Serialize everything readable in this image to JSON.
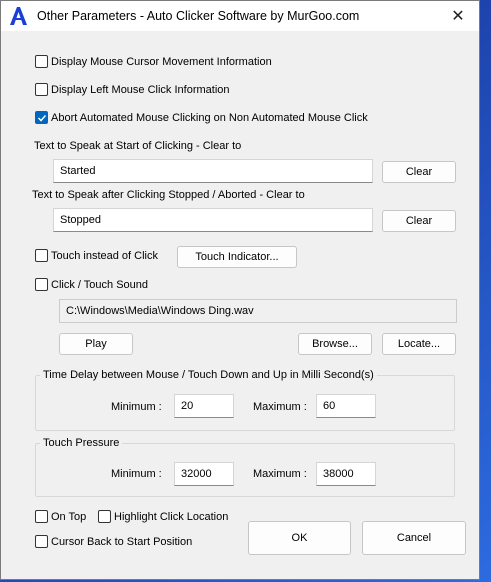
{
  "window": {
    "title": "Other Parameters - Auto Clicker Software by MurGoo.com",
    "close_glyph": "✕"
  },
  "options": {
    "display_cursor_movement": "Display Mouse Cursor Movement Information",
    "display_left_click": "Display Left Mouse Click Information",
    "abort_on_non_automated": "Abort Automated Mouse Clicking on Non Automated Mouse Click"
  },
  "speak_start": {
    "label": "Text to Speak at Start of Clicking - Clear to",
    "value": "Started",
    "clear_label": "Clear"
  },
  "speak_stop": {
    "label": "Text to Speak after Clicking Stopped / Aborted - Clear to",
    "value": "Stopped",
    "clear_label": "Clear"
  },
  "touch": {
    "touch_instead_label": "Touch instead of Click",
    "indicator_label": "Touch Indicator..."
  },
  "sound": {
    "label": "Click / Touch Sound",
    "path": "C:\\Windows\\Media\\Windows Ding.wav",
    "play_label": "Play",
    "browse_label": "Browse...",
    "locate_label": "Locate..."
  },
  "delay": {
    "title": "Time Delay between Mouse / Touch Down and Up in Milli Second(s)",
    "min_label": "Minimum :",
    "min_value": "20",
    "max_label": "Maximum :",
    "max_value": "60"
  },
  "pressure": {
    "title": "Touch Pressure",
    "min_label": "Minimum :",
    "min_value": "32000",
    "max_label": "Maximum :",
    "max_value": "38000"
  },
  "footer": {
    "on_top": "On Top",
    "highlight": "Highlight Click Location",
    "cursor_back": "Cursor Back to Start Position",
    "ok": "OK",
    "cancel": "Cancel"
  },
  "colors": {
    "accent": "#0067c0",
    "icon": "#1a3fd6"
  }
}
